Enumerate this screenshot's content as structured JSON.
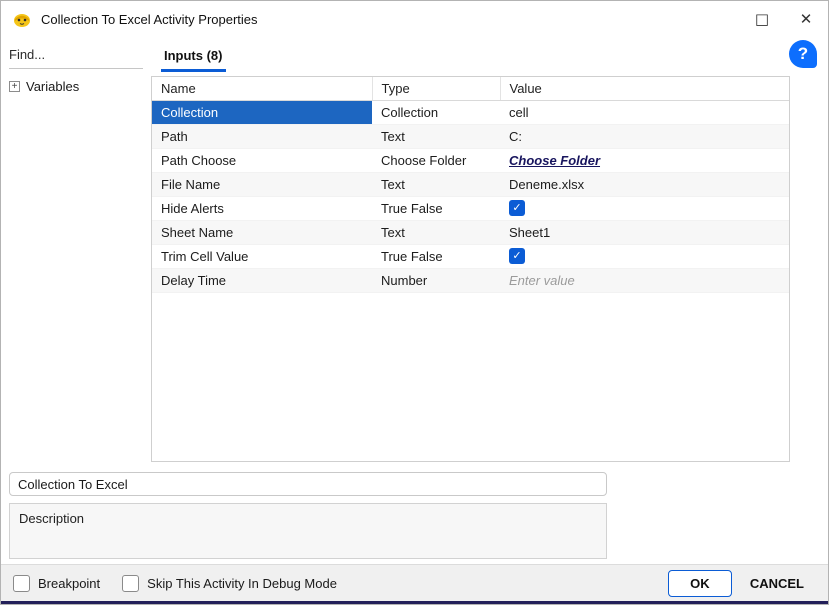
{
  "title_bar": {
    "title": "Collection To Excel Activity Properties"
  },
  "icons": {
    "app_icon": "bee-app-icon",
    "maximize_glyph": "□",
    "close_glyph": "✕",
    "help_glyph": "?",
    "expander_plus": "+",
    "checkmark": "✓"
  },
  "sidebar": {
    "find_label": "Find...",
    "tree": [
      {
        "label": "Variables"
      }
    ]
  },
  "tabs": [
    {
      "label": "Inputs (8)",
      "active": true
    }
  ],
  "table": {
    "columns": [
      "Name",
      "Type",
      "Value"
    ],
    "rows": [
      {
        "name": "Collection",
        "type": "Collection",
        "value": "cell",
        "value_kind": "text",
        "selected": true
      },
      {
        "name": "Path",
        "type": "Text",
        "value": "C:",
        "value_kind": "text"
      },
      {
        "name": "Path Choose",
        "type": "Choose Folder",
        "value": "Choose Folder",
        "value_kind": "link"
      },
      {
        "name": "File Name",
        "type": "Text",
        "value": "Deneme.xlsx",
        "value_kind": "text"
      },
      {
        "name": "Hide Alerts",
        "type": "True False",
        "value": true,
        "value_kind": "checkbox"
      },
      {
        "name": "Sheet Name",
        "type": "Text",
        "value": "Sheet1",
        "value_kind": "text"
      },
      {
        "name": "Trim Cell Value",
        "type": "True False",
        "value": true,
        "value_kind": "checkbox"
      },
      {
        "name": "Delay Time",
        "type": "Number",
        "value": "",
        "placeholder": "Enter value",
        "value_kind": "placeholder"
      }
    ]
  },
  "activity_name": {
    "value": "Collection To Excel"
  },
  "description": {
    "label": "Description"
  },
  "footer": {
    "breakpoint_label": "Breakpoint",
    "skip_label": "Skip This Activity In Debug Mode",
    "ok_label": "OK",
    "cancel_label": "CANCEL"
  },
  "colors": {
    "accent": "#0b5cd5",
    "selected_row": "#1d66c1",
    "help_blue": "#0d6efd",
    "window_edge": "#23205a"
  }
}
